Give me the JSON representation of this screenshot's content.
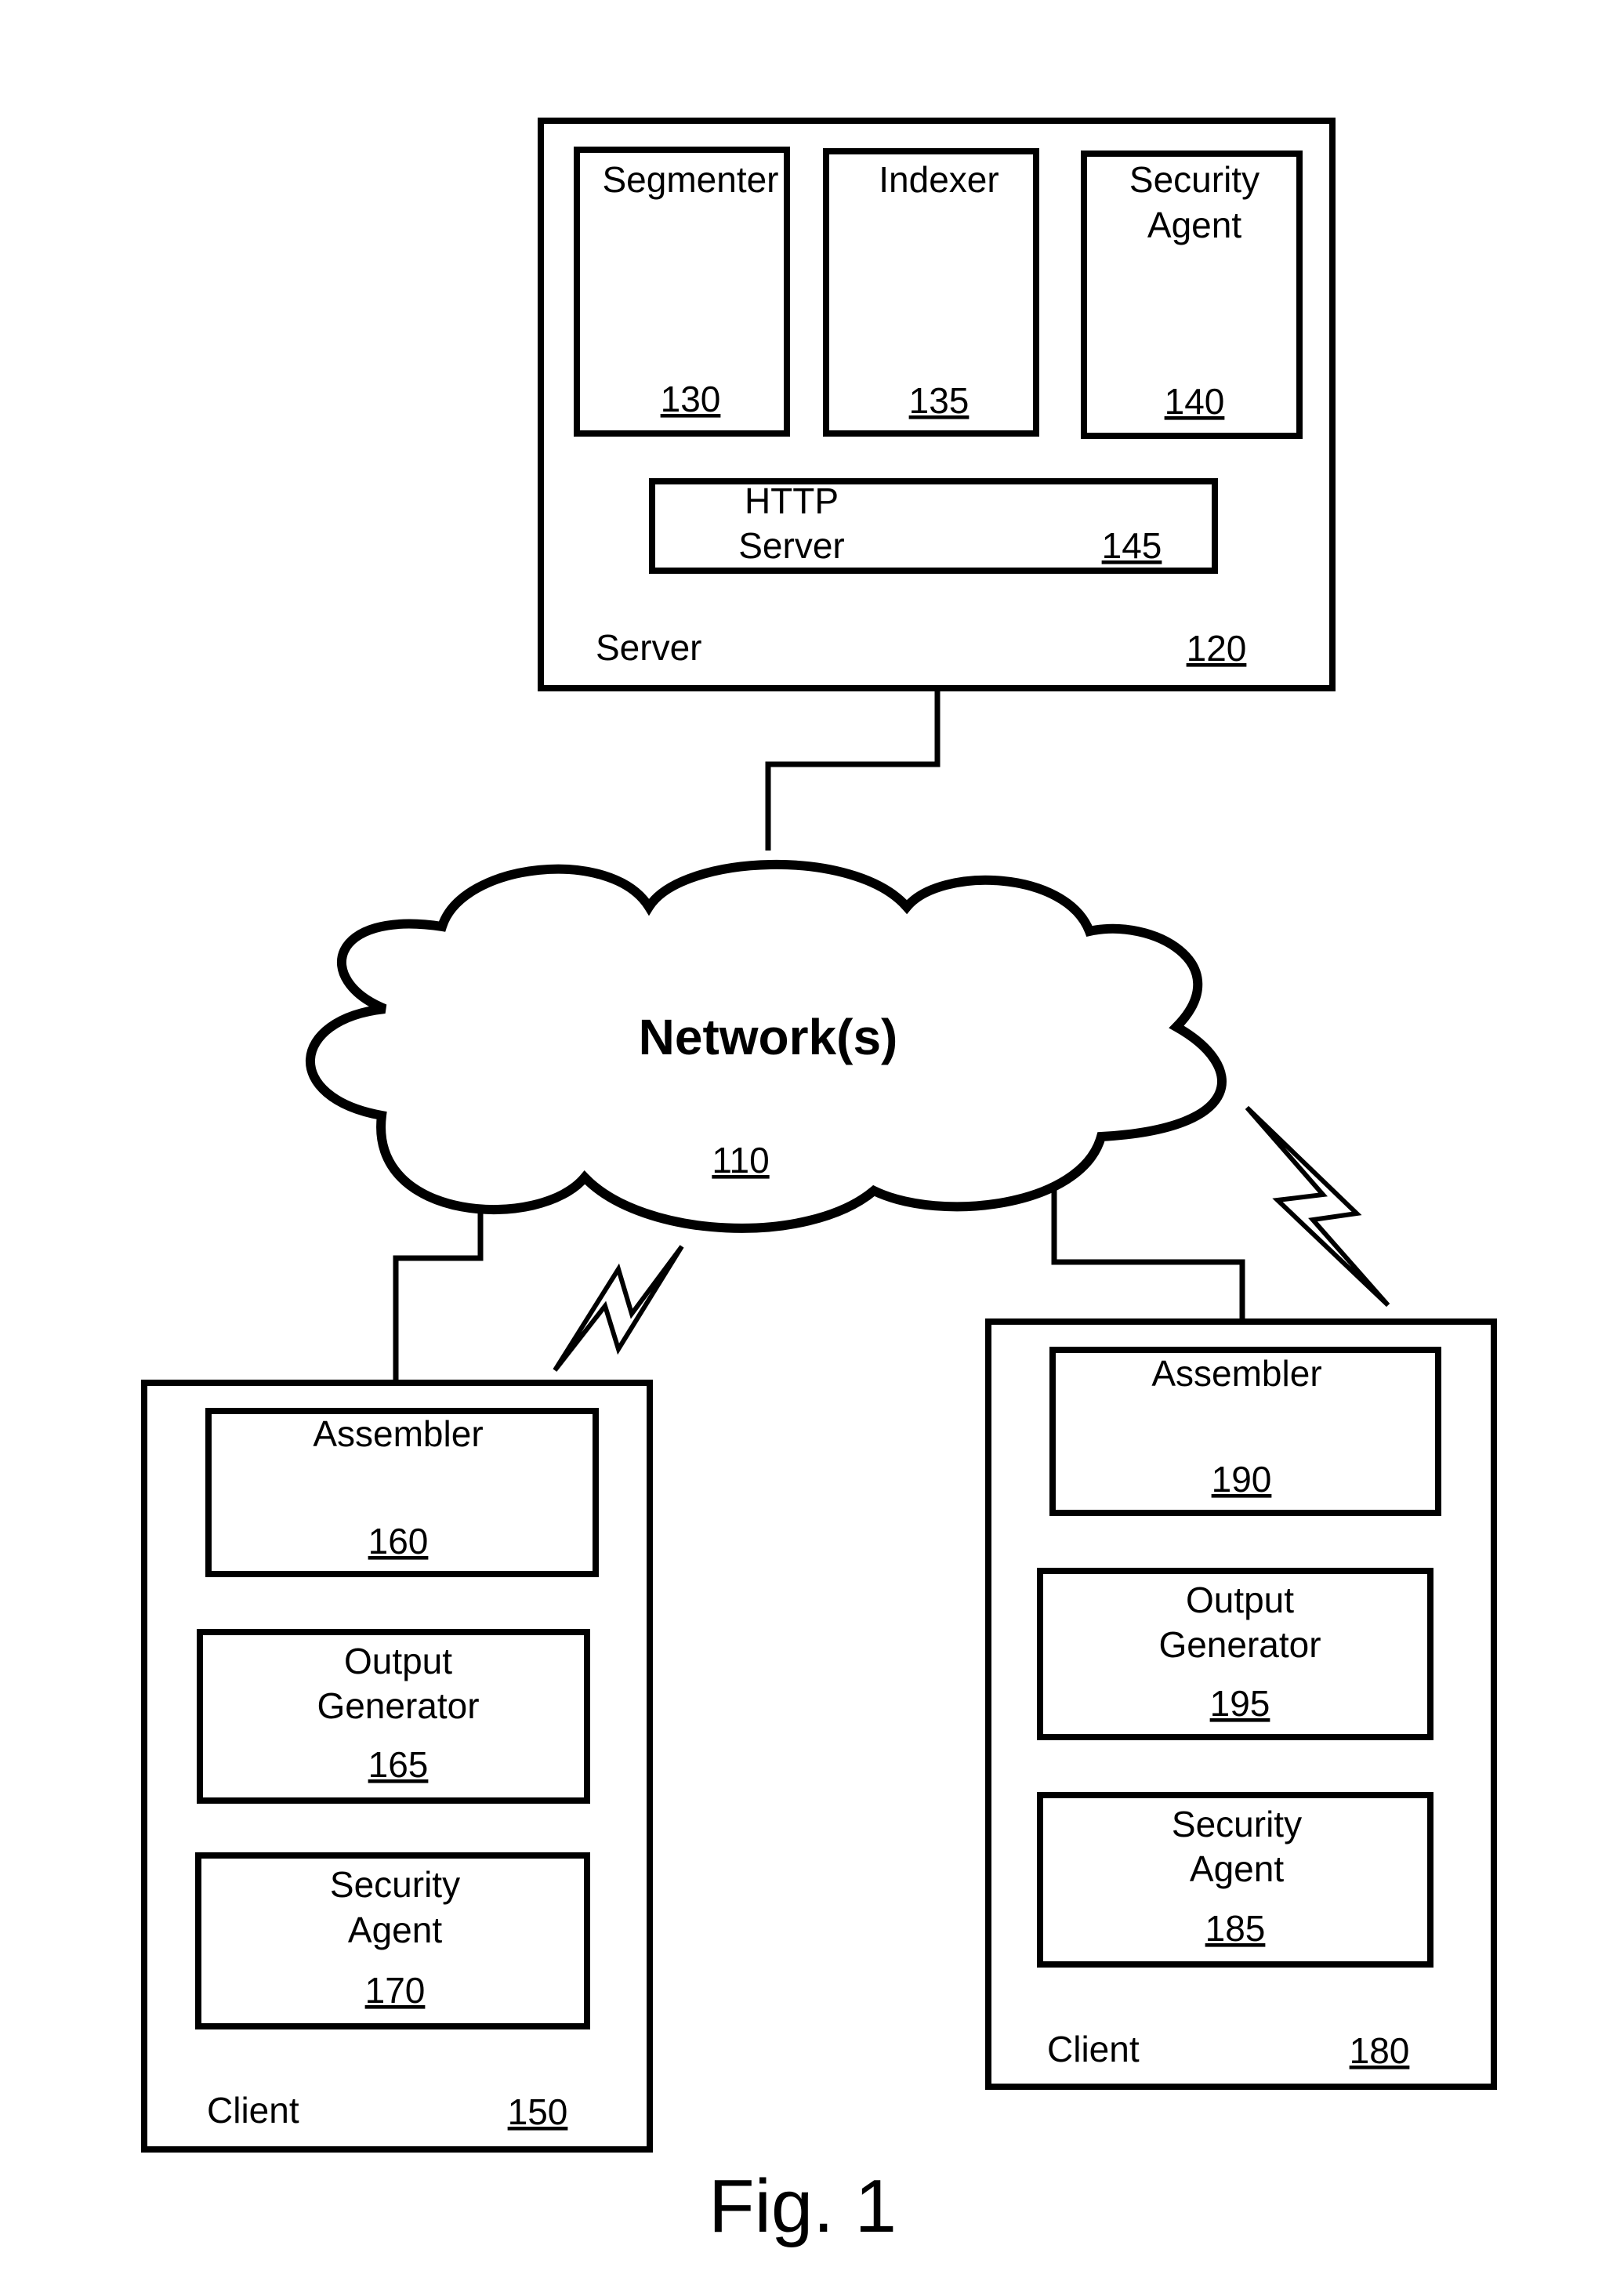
{
  "figure": {
    "caption": "Fig. 1",
    "network": {
      "label": "Network(s)",
      "ref": "110"
    },
    "server": {
      "label": "Server",
      "ref": "120",
      "components": [
        {
          "id": "segmenter",
          "lines": [
            "Segmenter"
          ],
          "ref": "130"
        },
        {
          "id": "indexer",
          "lines": [
            "Indexer"
          ],
          "ref": "135"
        },
        {
          "id": "security-agent",
          "lines": [
            "Security",
            "Agent"
          ],
          "ref": "140"
        },
        {
          "id": "http-server",
          "lines": [
            "HTTP",
            "Server"
          ],
          "ref": "145"
        }
      ]
    },
    "clients": [
      {
        "label": "Client",
        "ref": "150",
        "components": [
          {
            "id": "assembler",
            "lines": [
              "Assembler"
            ],
            "ref": "160"
          },
          {
            "id": "output-generator",
            "lines": [
              "Output",
              "Generator"
            ],
            "ref": "165"
          },
          {
            "id": "security-agent",
            "lines": [
              "Security",
              "Agent"
            ],
            "ref": "170"
          }
        ]
      },
      {
        "label": "Client",
        "ref": "180",
        "components": [
          {
            "id": "assembler",
            "lines": [
              "Assembler"
            ],
            "ref": "190"
          },
          {
            "id": "output-generator",
            "lines": [
              "Output",
              "Generator"
            ],
            "ref": "195"
          },
          {
            "id": "security-agent",
            "lines": [
              "Security",
              "Agent"
            ],
            "ref": "185"
          }
        ]
      }
    ],
    "connections": [
      {
        "from": "server",
        "to": "network",
        "kind": "wired"
      },
      {
        "from": "network",
        "to": "client-150",
        "kind": "wired"
      },
      {
        "from": "network",
        "to": "client-150",
        "kind": "wireless"
      },
      {
        "from": "network",
        "to": "client-180",
        "kind": "wired"
      },
      {
        "from": "network",
        "to": "client-180",
        "kind": "wireless"
      }
    ]
  }
}
